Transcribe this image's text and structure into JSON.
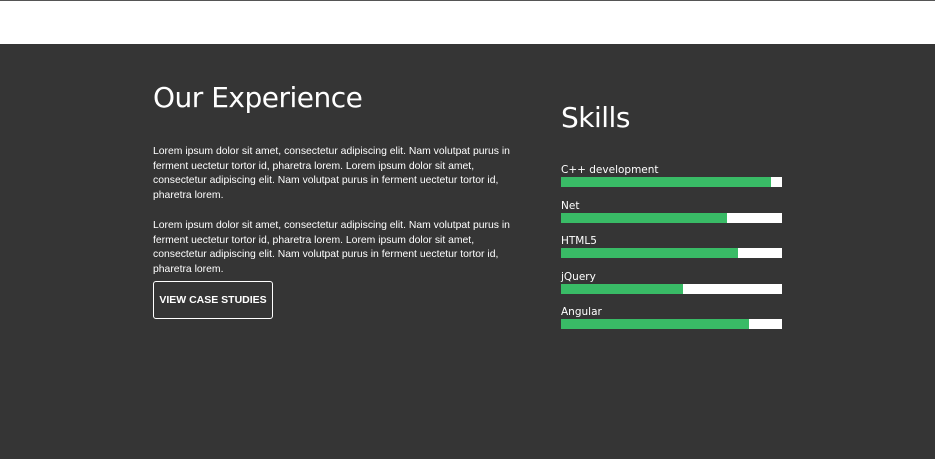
{
  "experience": {
    "title": "Our Experience",
    "paragraphs": [
      "Lorem ipsum dolor sit amet, consectetur adipiscing elit. Nam volutpat purus in ferment uectetur tortor id, pharetra lorem. Lorem ipsum dolor sit amet, consectetur adipiscing elit. Nam volutpat purus in ferment uectetur tortor id, pharetra lorem.",
      "Lorem ipsum dolor sit amet, consectetur adipiscing elit. Nam volutpat purus in ferment uectetur tortor id, pharetra lorem. Lorem ipsum dolor sit amet, consectetur adipiscing elit. Nam volutpat purus in ferment uectetur tortor id, pharetra lorem."
    ],
    "button_label": "VIEW CASE STUDIES"
  },
  "skills": {
    "title": "Skills",
    "items": [
      {
        "label": "C++ development",
        "level": 0.95
      },
      {
        "label": "Net",
        "level": 0.75
      },
      {
        "label": "HTML5",
        "level": 0.8
      },
      {
        "label": "jQuery",
        "level": 0.55
      },
      {
        "label": "Angular",
        "level": 0.85
      }
    ]
  },
  "colors": {
    "section_background": "#353535",
    "bar_fill": "#39bb66",
    "bar_track": "#ffffff",
    "text": "#ffffff"
  }
}
